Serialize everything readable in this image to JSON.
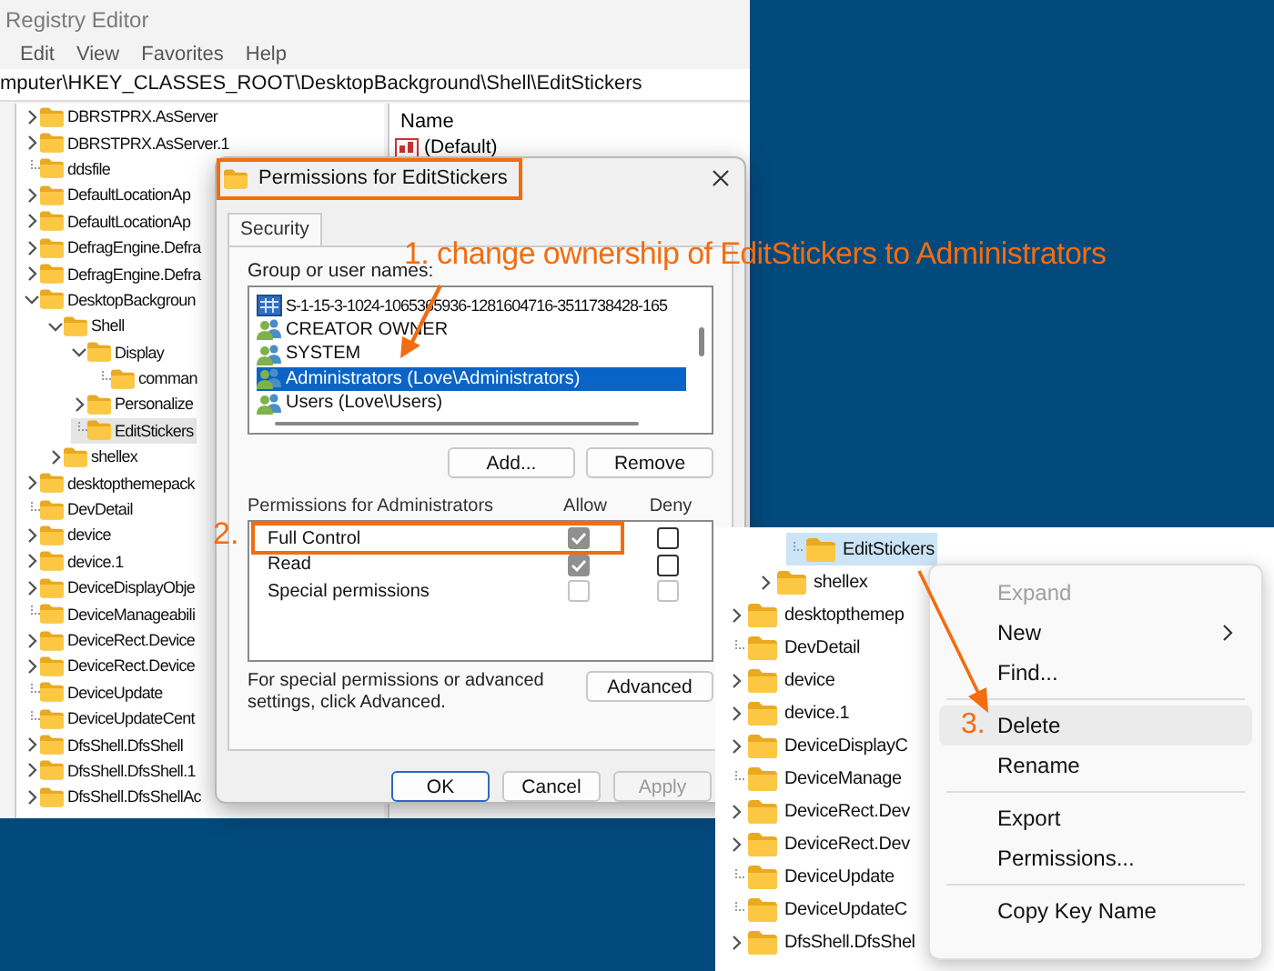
{
  "registry_window": {
    "title": "Registry Editor",
    "menu": [
      "Edit",
      "View",
      "Favorites",
      "Help"
    ],
    "address": "mputer\\HKEY_CLASSES_ROOT\\DesktopBackground\\Shell\\EditStickers",
    "tree": [
      {
        "label": "DBRSTPRX.AsServer",
        "kind": "branch",
        "expanded": false,
        "selected": false
      },
      {
        "label": "DBRSTPRX.AsServer.1",
        "kind": "branch",
        "expanded": false,
        "selected": false
      },
      {
        "label": "ddsfile",
        "kind": "leaf",
        "selected": false
      },
      {
        "label": "DefaultLocationAp",
        "kind": "branch",
        "expanded": false,
        "selected": false
      },
      {
        "label": "DefaultLocationAp",
        "kind": "branch",
        "expanded": false,
        "selected": false
      },
      {
        "label": "DefragEngine.Defra",
        "kind": "branch",
        "expanded": false,
        "selected": false
      },
      {
        "label": "DefragEngine.Defra",
        "kind": "branch",
        "expanded": false,
        "selected": false
      },
      {
        "label": "DesktopBackgroun",
        "kind": "branch",
        "expanded": true,
        "selected": false,
        "children": [
          {
            "label": "Shell",
            "kind": "branch",
            "expanded": true,
            "selected": false,
            "children": [
              {
                "label": "Display",
                "kind": "branch",
                "expanded": true,
                "selected": false,
                "children": [
                  {
                    "label": "comman",
                    "kind": "leaf",
                    "selected": false
                  }
                ]
              },
              {
                "label": "Personalize",
                "kind": "branch",
                "expanded": false,
                "selected": false
              },
              {
                "label": "EditStickers",
                "kind": "leaf",
                "selected": true
              }
            ]
          },
          {
            "label": "shellex",
            "kind": "branch",
            "expanded": false,
            "selected": false
          }
        ]
      },
      {
        "label": "desktopthemepack",
        "kind": "branch",
        "expanded": false,
        "selected": false
      },
      {
        "label": "DevDetail",
        "kind": "leaf",
        "selected": false
      },
      {
        "label": "device",
        "kind": "branch",
        "expanded": false,
        "selected": false
      },
      {
        "label": "device.1",
        "kind": "branch",
        "expanded": false,
        "selected": false
      },
      {
        "label": "DeviceDisplayObje",
        "kind": "branch",
        "expanded": false,
        "selected": false
      },
      {
        "label": "DeviceManageabili",
        "kind": "leaf",
        "selected": false
      },
      {
        "label": "DeviceRect.Device",
        "kind": "branch",
        "expanded": false,
        "selected": false
      },
      {
        "label": "DeviceRect.Device",
        "kind": "branch",
        "expanded": false,
        "selected": false
      },
      {
        "label": "DeviceUpdate",
        "kind": "leaf",
        "selected": false
      },
      {
        "label": "DeviceUpdateCent",
        "kind": "leaf",
        "selected": false
      },
      {
        "label": "DfsShell.DfsShell",
        "kind": "branch",
        "expanded": false,
        "selected": false
      },
      {
        "label": "DfsShell.DfsShell.1",
        "kind": "branch",
        "expanded": false,
        "selected": false
      },
      {
        "label": "DfsShell.DfsShellAc",
        "kind": "branch",
        "expanded": false,
        "selected": false
      }
    ],
    "values_pane": {
      "column": "Name",
      "rows": [
        "(Default)"
      ]
    }
  },
  "permissions_dialog": {
    "title": "Permissions for EditStickers",
    "title_highlighted": true,
    "tabs": [
      {
        "label": "Security",
        "selected": true
      }
    ],
    "group_label": "Group or user names:",
    "principals": [
      {
        "name": "S-1-15-3-1024-1065365936-1281604716-3511738428-165",
        "kind": "sid",
        "selected": false
      },
      {
        "name": "CREATOR OWNER",
        "kind": "group",
        "selected": false
      },
      {
        "name": "SYSTEM",
        "kind": "group",
        "selected": false
      },
      {
        "name": "Administrators (Love\\Administrators)",
        "kind": "group",
        "selected": true
      },
      {
        "name": "Users (Love\\Users)",
        "kind": "group",
        "selected": false
      }
    ],
    "principal_buttons": [
      "Add...",
      "Remove"
    ],
    "permissions_label": "Permissions for Administrators",
    "allow_label": "Allow",
    "deny_label": "Deny",
    "permissions": [
      {
        "name": "Full Control",
        "allow": true,
        "allow_disabled": true,
        "deny": false,
        "deny_disabled": false,
        "highlighted": true
      },
      {
        "name": "Read",
        "allow": true,
        "allow_disabled": true,
        "deny": false,
        "deny_disabled": false,
        "highlighted": false
      },
      {
        "name": "Special permissions",
        "allow": false,
        "allow_disabled": true,
        "deny": false,
        "deny_disabled": true,
        "highlighted": false
      }
    ],
    "advanced_note": "For special permissions or advanced settings, click Advanced.",
    "advanced_button": "Advanced",
    "buttons": [
      {
        "label": "OK",
        "default": true,
        "disabled": false
      },
      {
        "label": "Cancel",
        "default": false,
        "disabled": false
      },
      {
        "label": "Apply",
        "default": false,
        "disabled": true
      }
    ]
  },
  "annotations": {
    "step1": "1. change ownership of EditStickers to Administrators",
    "step2": "2."
  },
  "context_window": {
    "tree_fragment": {
      "deep_items": [
        {
          "label": "EditStickers",
          "kind": "leaf",
          "selected": true
        }
      ],
      "nested_items": [
        {
          "label": "shellex",
          "kind": "branch",
          "expanded": false,
          "selected": false
        }
      ],
      "items": [
        {
          "label": "desktopthemep",
          "kind": "branch",
          "expanded": false,
          "selected": false
        },
        {
          "label": "DevDetail",
          "kind": "leaf",
          "selected": false
        },
        {
          "label": "device",
          "kind": "branch",
          "expanded": false,
          "selected": false
        },
        {
          "label": "device.1",
          "kind": "branch",
          "expanded": false,
          "selected": false
        },
        {
          "label": "DeviceDisplayC",
          "kind": "branch",
          "expanded": false,
          "selected": false
        },
        {
          "label": "DeviceManage",
          "kind": "leaf",
          "selected": false
        },
        {
          "label": "DeviceRect.Dev",
          "kind": "branch",
          "expanded": false,
          "selected": false
        },
        {
          "label": "DeviceRect.Dev",
          "kind": "branch",
          "expanded": false,
          "selected": false
        },
        {
          "label": "DeviceUpdate",
          "kind": "leaf",
          "selected": false
        },
        {
          "label": "DeviceUpdateC",
          "kind": "leaf",
          "selected": false
        },
        {
          "label": "DfsShell.DfsShel",
          "kind": "branch",
          "expanded": false,
          "selected": false
        }
      ]
    },
    "menu": [
      {
        "kind": "item",
        "label": "Expand",
        "disabled": true,
        "submenu": false,
        "selected": false
      },
      {
        "kind": "item",
        "label": "New",
        "disabled": false,
        "submenu": true,
        "selected": false
      },
      {
        "kind": "item",
        "label": "Find...",
        "disabled": false,
        "submenu": false,
        "selected": false
      },
      {
        "kind": "separator"
      },
      {
        "kind": "item",
        "label": "Delete",
        "disabled": false,
        "submenu": false,
        "selected": true,
        "step": "3."
      },
      {
        "kind": "item",
        "label": "Rename",
        "disabled": false,
        "submenu": false,
        "selected": false
      },
      {
        "kind": "separator"
      },
      {
        "kind": "item",
        "label": "Export",
        "disabled": false,
        "submenu": false,
        "selected": false
      },
      {
        "kind": "item",
        "label": "Permissions...",
        "disabled": false,
        "submenu": false,
        "selected": false
      },
      {
        "kind": "separator"
      },
      {
        "kind": "item",
        "label": "Copy Key Name",
        "disabled": false,
        "submenu": false,
        "selected": false
      }
    ]
  }
}
